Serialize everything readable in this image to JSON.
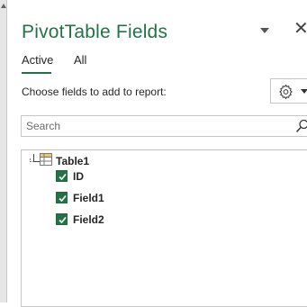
{
  "panel": {
    "title": "PivotTable Fields",
    "close_glyph": "✕"
  },
  "tabs": [
    {
      "label": "Active",
      "selected": true
    },
    {
      "label": "All",
      "selected": false
    }
  ],
  "choose_label": "Choose fields to add to report:",
  "search": {
    "placeholder": "Search",
    "value": ""
  },
  "tree": {
    "table_name": "Table1",
    "expanded": true,
    "fields": [
      {
        "label": "ID",
        "checked": true
      },
      {
        "label": "Field1",
        "checked": true
      },
      {
        "label": "Field2",
        "checked": true
      }
    ]
  },
  "icons": {
    "settings": "gear-icon",
    "search": "search-icon",
    "table": "table-icon",
    "caret": "chevron-down-icon",
    "close": "close-icon"
  },
  "colors": {
    "accent": "#217346",
    "text": "#262626",
    "border": "#c6c6c6"
  }
}
